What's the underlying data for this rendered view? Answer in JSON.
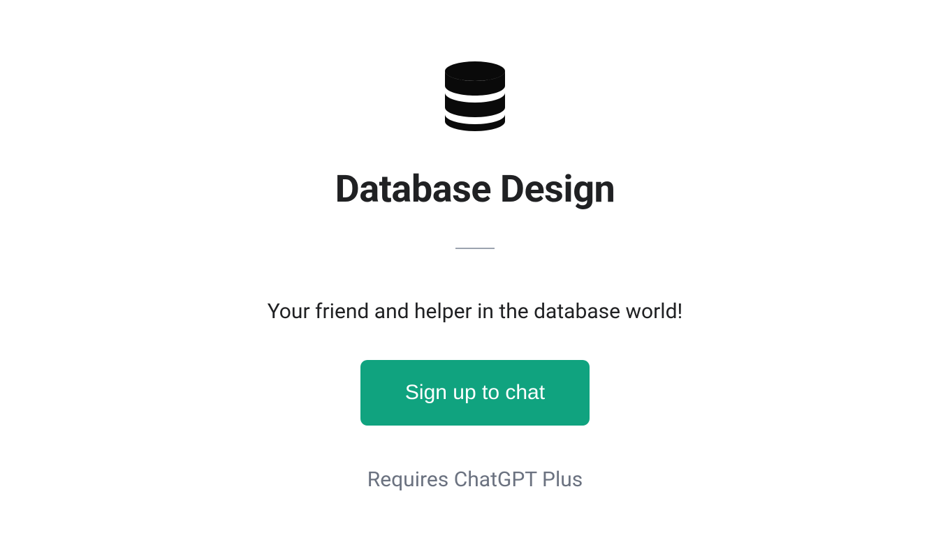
{
  "icon": "database-icon",
  "title": "Database Design",
  "subtitle": "Your friend and helper in the database world!",
  "cta_label": "Sign up to chat",
  "requirement": "Requires ChatGPT Plus",
  "colors": {
    "accent": "#10a37f",
    "text_primary": "#202123",
    "text_secondary": "#6b7280"
  }
}
